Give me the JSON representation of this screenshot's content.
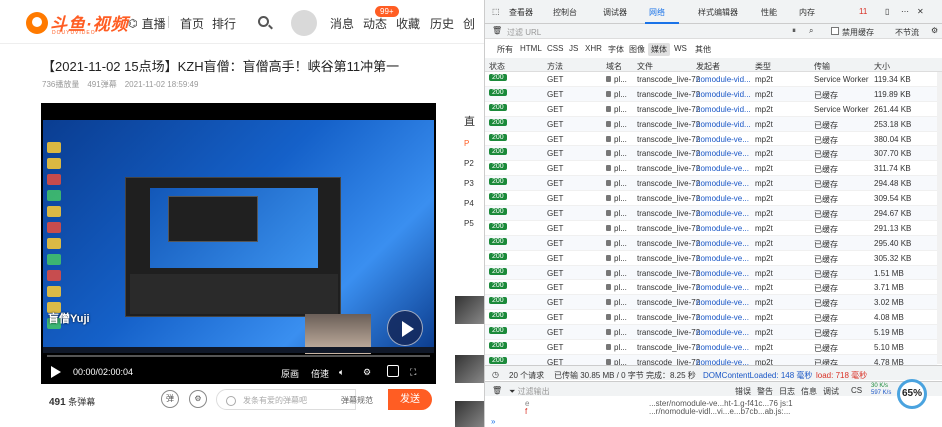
{
  "site": {
    "logo_text": "斗鱼·视频",
    "logo_sub": "DOUYUVIDEO",
    "nav_live": "直播",
    "nav_home": "首页",
    "nav_rank": "排行",
    "nav_msg": "消息",
    "nav_dynamic": "动态",
    "nav_dynamic_badge": "99+",
    "nav_fav": "收藏",
    "nav_history": "历史",
    "nav_create": "创"
  },
  "video": {
    "title": "【2021-11-02 15点场】KZH盲僧：盲僧高手！峡谷第11冲第一",
    "plays": "736播放量",
    "danmu_total": "491弹幕",
    "date": "2021-11-02 18:59:49",
    "streamer_watermark": "盲僧Yuji",
    "time": "00:00/02:00:04",
    "quality": "原画",
    "speed": "倍速"
  },
  "danmu_bar": {
    "count": "491",
    "count_label": "条弹幕",
    "btn_danmu": "弹",
    "placeholder": "发条有爱的弹幕吧",
    "rule": "弹幕规范",
    "send": "发送"
  },
  "sidebar": {
    "header": "直",
    "items": [
      "P",
      "P2",
      "P3",
      "P4",
      "P5"
    ]
  },
  "devtools": {
    "tabs": [
      "查看器",
      "控制台",
      "调试器",
      "网络",
      "样式编辑器",
      "性能",
      "内存"
    ],
    "error_count": "11",
    "filter_placeholder": "过滤 URL",
    "disable_cache": "禁用缓存",
    "throttle": "不节流",
    "types": [
      "所有",
      "HTML",
      "CSS",
      "JS",
      "XHR",
      "字体",
      "图像",
      "媒体",
      "WS",
      "其他"
    ],
    "columns": [
      "状态",
      "方法",
      "域名",
      "文件",
      "发起者",
      "类型",
      "传输",
      "大小"
    ],
    "rows": [
      {
        "status": "200",
        "method": "GET",
        "domain": "pl...",
        "file": "transcode_live-72",
        "initiator": "nomodule-vid...",
        "type": "mp2t",
        "transfer": "Service Worker",
        "size": "119.34 KB"
      },
      {
        "status": "200",
        "method": "GET",
        "domain": "pl...",
        "file": "transcode_live-72",
        "initiator": "nomodule-vid...",
        "type": "mp2t",
        "transfer": "已缓存",
        "size": "119.89 KB"
      },
      {
        "status": "200",
        "method": "GET",
        "domain": "pl...",
        "file": "transcode_live-72",
        "initiator": "nomodule-vid...",
        "type": "mp2t",
        "transfer": "Service Worker",
        "size": "261.44 KB"
      },
      {
        "status": "200",
        "method": "GET",
        "domain": "pl...",
        "file": "transcode_live-72",
        "initiator": "nomodule-vid...",
        "type": "mp2t",
        "transfer": "已缓存",
        "size": "253.18 KB"
      },
      {
        "status": "200",
        "method": "GET",
        "domain": "pl...",
        "file": "transcode_live-72",
        "initiator": "nomodule-ve...",
        "type": "mp2t",
        "transfer": "已缓存",
        "size": "380.04 KB"
      },
      {
        "status": "200",
        "method": "GET",
        "domain": "pl...",
        "file": "transcode_live-72",
        "initiator": "nomodule-ve...",
        "type": "mp2t",
        "transfer": "已缓存",
        "size": "307.70 KB"
      },
      {
        "status": "200",
        "method": "GET",
        "domain": "pl...",
        "file": "transcode_live-72",
        "initiator": "nomodule-ve...",
        "type": "mp2t",
        "transfer": "已缓存",
        "size": "311.74 KB"
      },
      {
        "status": "200",
        "method": "GET",
        "domain": "pl...",
        "file": "transcode_live-72",
        "initiator": "nomodule-ve...",
        "type": "mp2t",
        "transfer": "已缓存",
        "size": "294.48 KB"
      },
      {
        "status": "200",
        "method": "GET",
        "domain": "pl...",
        "file": "transcode_live-72",
        "initiator": "nomodule-ve...",
        "type": "mp2t",
        "transfer": "已缓存",
        "size": "309.54 KB"
      },
      {
        "status": "200",
        "method": "GET",
        "domain": "pl...",
        "file": "transcode_live-72",
        "initiator": "nomodule-ve...",
        "type": "mp2t",
        "transfer": "已缓存",
        "size": "294.67 KB"
      },
      {
        "status": "200",
        "method": "GET",
        "domain": "pl...",
        "file": "transcode_live-72",
        "initiator": "nomodule-ve...",
        "type": "mp2t",
        "transfer": "已缓存",
        "size": "291.13 KB"
      },
      {
        "status": "200",
        "method": "GET",
        "domain": "pl...",
        "file": "transcode_live-72",
        "initiator": "nomodule-ve...",
        "type": "mp2t",
        "transfer": "已缓存",
        "size": "295.40 KB"
      },
      {
        "status": "200",
        "method": "GET",
        "domain": "pl...",
        "file": "transcode_live-72",
        "initiator": "nomodule-ve...",
        "type": "mp2t",
        "transfer": "已缓存",
        "size": "305.32 KB"
      },
      {
        "status": "200",
        "method": "GET",
        "domain": "pl...",
        "file": "transcode_live-72",
        "initiator": "nomodule-ve...",
        "type": "mp2t",
        "transfer": "已缓存",
        "size": "1.51 MB"
      },
      {
        "status": "200",
        "method": "GET",
        "domain": "pl...",
        "file": "transcode_live-72",
        "initiator": "nomodule-ve...",
        "type": "mp2t",
        "transfer": "已缓存",
        "size": "3.71 MB"
      },
      {
        "status": "200",
        "method": "GET",
        "domain": "pl...",
        "file": "transcode_live-72",
        "initiator": "nomodule-ve...",
        "type": "mp2t",
        "transfer": "已缓存",
        "size": "3.02 MB"
      },
      {
        "status": "200",
        "method": "GET",
        "domain": "pl...",
        "file": "transcode_live-72",
        "initiator": "nomodule-ve...",
        "type": "mp2t",
        "transfer": "已缓存",
        "size": "4.08 MB"
      },
      {
        "status": "200",
        "method": "GET",
        "domain": "pl...",
        "file": "transcode_live-72",
        "initiator": "nomodule-ve...",
        "type": "mp2t",
        "transfer": "已缓存",
        "size": "5.19 MB"
      },
      {
        "status": "200",
        "method": "GET",
        "domain": "pl...",
        "file": "transcode_live-72",
        "initiator": "nomodule-ve...",
        "type": "mp2t",
        "transfer": "已缓存",
        "size": "5.10 MB"
      },
      {
        "status": "200",
        "method": "GET",
        "domain": "pl...",
        "file": "transcode_live-72",
        "initiator": "nomodule-ve...",
        "type": "mp2t",
        "transfer": "已缓存",
        "size": "4.78 MB"
      }
    ],
    "status_bar": {
      "requests": "20 个请求",
      "transferred": "已传输 30.85 MB / 0 字节",
      "finish": "完成：8.25 秒",
      "dcl": "DOMContentLoaded: 148 毫秒",
      "load": "load: 718 毫秒"
    },
    "console_bar": {
      "filter": "过滤输出",
      "levels": [
        "错误",
        "警告",
        "日志",
        "信息",
        "调试"
      ],
      "css": "CS",
      "speed_up": "30 K/s",
      "speed_down": "597 K/s"
    },
    "console_lines": [
      "...ster/nomodule-ve...ht-1.g-f41c...76 js:1",
      "...r/nomodule-vidl...vi...e...b7cb...ab.js:..."
    ],
    "perf_pct": "65%"
  },
  "colors": {
    "brand": "#ff5d23",
    "status_ok": "#1b8a3a",
    "link": "#1a57c6",
    "active_tab": "#1a73e8"
  }
}
